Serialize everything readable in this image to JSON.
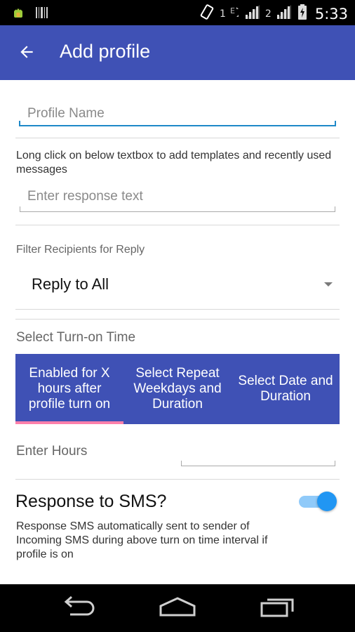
{
  "status_bar": {
    "sim1_label": "1",
    "sim2_label": "2",
    "time": "5:33",
    "icons": [
      "android-debug-icon",
      "barcode-icon",
      "vibrate-icon",
      "signal-icon",
      "signal-icon",
      "battery-charging-icon"
    ]
  },
  "app_bar": {
    "title": "Add profile",
    "back_icon": "arrow-left-icon",
    "background": "#3f51b5"
  },
  "form": {
    "profile_name": {
      "value": "",
      "placeholder": "Profile Name"
    },
    "response_hint": "Long click on below textbox to add templates and recently used messages",
    "response_text": {
      "value": "",
      "placeholder": "Enter response text"
    },
    "filter_label": "Filter Recipients for Reply",
    "filter_selected": "Reply to All",
    "turn_on_label": "Select Turn-on Time",
    "tabs": [
      {
        "label": "Enabled for X hours after profile turn on",
        "active": true
      },
      {
        "label": "Select Repeat Weekdays and Duration",
        "active": false
      },
      {
        "label": "Select Date and Duration",
        "active": false
      }
    ],
    "hours_label": "Enter Hours",
    "hours_value": "",
    "sms_title": "Response to SMS?",
    "sms_enabled": true,
    "sms_description": "Response SMS automatically sent to sender of Incoming SMS during above turn on time interval if profile is on"
  },
  "colors": {
    "primary": "#3f51b5",
    "tab_indicator": "#ff80ab",
    "switch_thumb": "#2196f3",
    "switch_track": "#90caf9",
    "input_focus": "#1e88c8"
  },
  "nav_bar": {
    "icons": [
      "back-nav-icon",
      "home-nav-icon",
      "recents-nav-icon"
    ]
  }
}
